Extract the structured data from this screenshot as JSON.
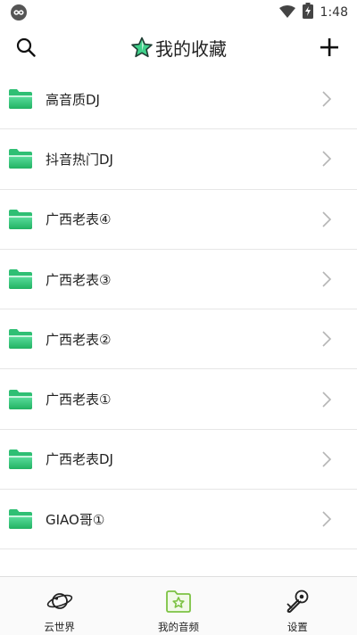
{
  "status_bar": {
    "time": "1:48",
    "icons": [
      "app-indicator-icon",
      "wifi-icon",
      "battery-charging-icon"
    ]
  },
  "header": {
    "title": "我的收藏",
    "left_icon": "search-icon",
    "right_icon": "plus-icon",
    "title_icon": "star-icon"
  },
  "folders": [
    {
      "label": "高音质DJ"
    },
    {
      "label": "抖音热门DJ"
    },
    {
      "label": "广西老表④"
    },
    {
      "label": "广西老表③"
    },
    {
      "label": "广西老表②"
    },
    {
      "label": "广西老表①"
    },
    {
      "label": "广西老表DJ"
    },
    {
      "label": "GIAO哥①"
    }
  ],
  "bottom_nav": {
    "items": [
      {
        "label": "云世界",
        "icon": "planet-icon",
        "active": false
      },
      {
        "label": "我的音频",
        "icon": "folder-star-icon",
        "active": true
      },
      {
        "label": "设置",
        "icon": "wrench-gear-icon",
        "active": false
      }
    ]
  },
  "colors": {
    "accent": "#3cc97a",
    "accent_dark": "#22b263",
    "nav_active": "#7cc243",
    "divider": "#e6e6e6"
  }
}
